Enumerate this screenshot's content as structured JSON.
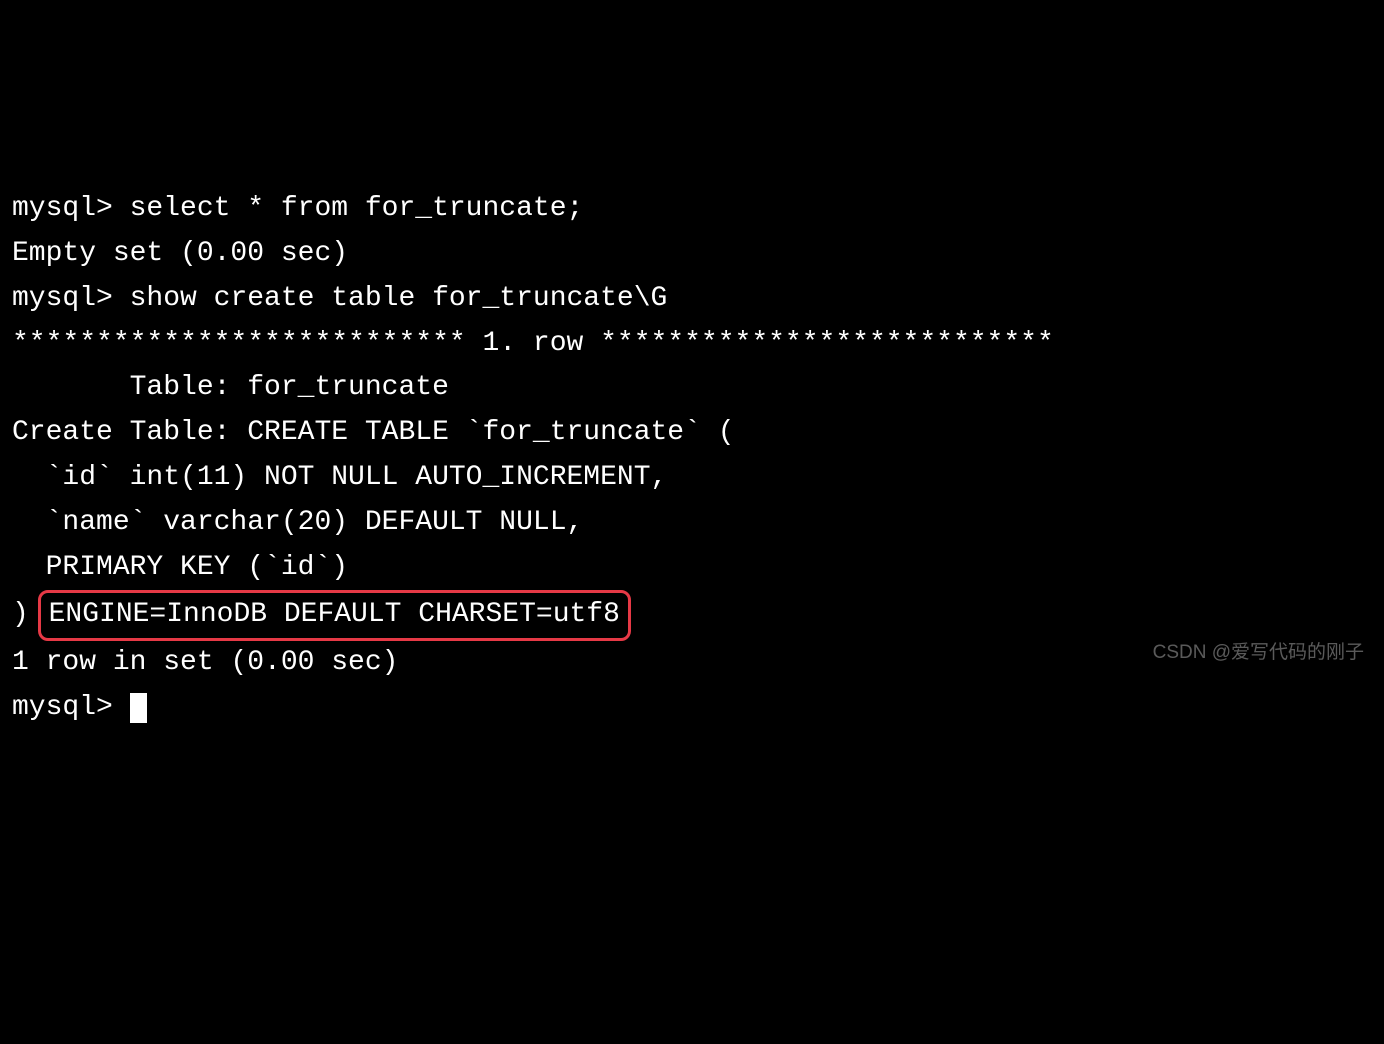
{
  "terminal": {
    "prompt": "mysql> ",
    "query1": "select * from for_truncate;",
    "result1": "Empty set (0.00 sec)",
    "blank": "",
    "query2": "show create table for_truncate\\G",
    "row_separator": "*************************** 1. row ***************************",
    "table_line": "       Table: for_truncate",
    "create_line1": "Create Table: CREATE TABLE `for_truncate` (",
    "create_line2": "  `id` int(11) NOT NULL AUTO_INCREMENT,",
    "create_line3": "  `name` varchar(20) DEFAULT NULL,",
    "create_line4": "  PRIMARY KEY (`id`)",
    "create_line5_prefix": ") ",
    "create_line5_highlight": "ENGINE=InnoDB DEFAULT CHARSET=utf8",
    "result2": "1 row in set (0.00 sec)"
  },
  "watermark": "CSDN @爱写代码的刚子"
}
